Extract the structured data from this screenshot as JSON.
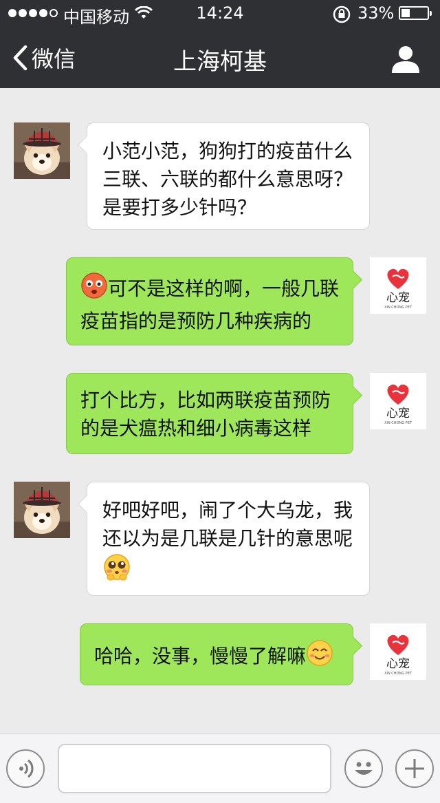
{
  "status_bar": {
    "carrier": "中国移动",
    "time": "14:24",
    "battery": "33%",
    "battery_level": 0.33
  },
  "nav": {
    "back_label": "微信",
    "title": "上海柯基",
    "profile_icon": "person-icon"
  },
  "brand": {
    "logo_text": "心宠",
    "logo_subtext": "XIN CHONG PET"
  },
  "messages": [
    {
      "side": "left",
      "text": "小范小范，狗狗打的疫苗什么三联、六联的都什么意思呀？是要打多少针吗？",
      "emoji": ""
    },
    {
      "side": "right",
      "text": "可不是这样的啊，一般几联疫苗指的是预防几种疾病的",
      "emoji": "blush-emoji",
      "emoji_position": "start"
    },
    {
      "side": "right",
      "text": "打个比方，比如两联疫苗预防的是犬瘟热和细小病毒这样",
      "emoji": ""
    },
    {
      "side": "left",
      "text": "好吧好吧，闹了个大乌龙，我还以为是几联是几针的意思呢",
      "emoji": "shy-emoji",
      "emoji_position": "end"
    },
    {
      "side": "right",
      "text": "哈哈，没事，慢慢了解嘛",
      "emoji": "smile-emoji",
      "emoji_position": "end"
    }
  ],
  "input_bar": {
    "voice_icon": "voice-icon",
    "input_value": "",
    "emoji_icon": "emoji-face-icon",
    "plus_icon": "plus-icon"
  },
  "colors": {
    "nav_bg": "#2e3034",
    "chat_bg": "#ebebeb",
    "bubble_sent": "#9ee75a",
    "bubble_received": "#ffffff",
    "brand_red": "#e8333c"
  }
}
